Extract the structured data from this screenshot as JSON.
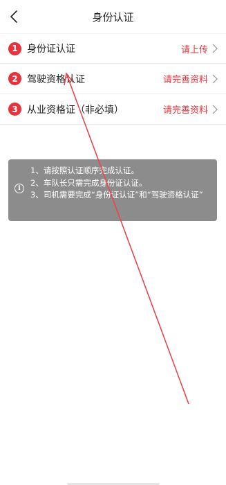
{
  "header": {
    "title": "身份认证",
    "back_icon": "chevron-left-icon"
  },
  "items": [
    {
      "number": "1",
      "label": "身份证认证",
      "action": "请上传"
    },
    {
      "number": "2",
      "label": "驾驶资格认证",
      "action": "请完善资料"
    },
    {
      "number": "3",
      "label": "从业资格证（非必填）",
      "action": "请完善资料"
    }
  ],
  "notice": {
    "icon": "info-icon",
    "lines": [
      "1、请按照认证顺序完成认证。",
      "2、车队长只需完成身份证认证。",
      "3、司机需要完成“身份证认证”和“驾驶资格认证”"
    ]
  },
  "colors": {
    "accent": "#e6323a",
    "notice_bg": "#8c8c8c",
    "annotation": "#e8474b"
  }
}
